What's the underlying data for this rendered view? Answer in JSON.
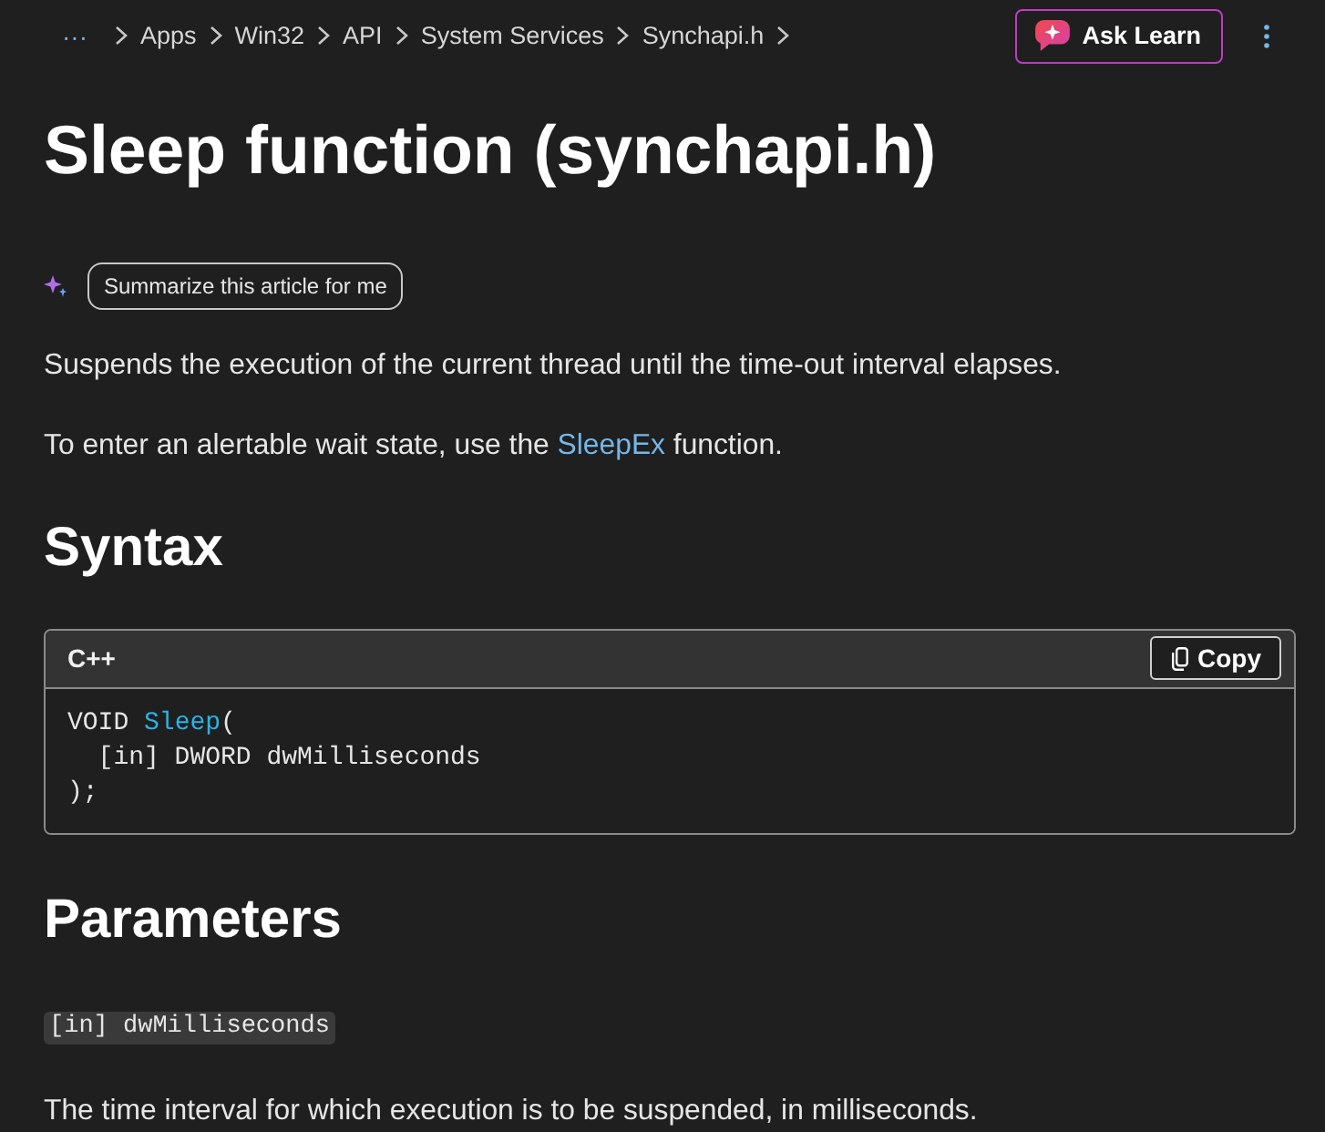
{
  "breadcrumb": {
    "overflow": "···",
    "items": [
      "Apps",
      "Win32",
      "API",
      "System Services",
      "Synchapi.h"
    ]
  },
  "ask_button": {
    "label": "Ask Learn"
  },
  "title": "Sleep function (synchapi.h)",
  "summarize_button": {
    "label": "Summarize this article for me"
  },
  "intro": [
    {
      "segments": [
        {
          "kind": "text",
          "text": "Suspends the execution of the current thread until the time-out interval elapses."
        }
      ]
    },
    {
      "segments": [
        {
          "kind": "text",
          "text": "To enter an alertable wait state, use the "
        },
        {
          "kind": "link",
          "text": "SleepEx"
        },
        {
          "kind": "text",
          "text": " function."
        }
      ]
    }
  ],
  "syntax": {
    "heading": "Syntax",
    "code_block": {
      "language": "C++",
      "copy_label": "Copy",
      "lines": [
        [
          {
            "kind": "plain",
            "text": "VOID "
          },
          {
            "kind": "function",
            "text": "Sleep"
          },
          {
            "kind": "plain",
            "text": "("
          }
        ],
        [
          {
            "kind": "plain",
            "text": "  [in] DWORD dwMilliseconds"
          }
        ],
        [
          {
            "kind": "plain",
            "text": ");"
          }
        ]
      ]
    }
  },
  "parameters": {
    "heading": "Parameters",
    "items": [
      {
        "name": "[in] dwMilliseconds",
        "description": "The time interval for which execution is to be suspended, in milliseconds."
      }
    ]
  }
}
